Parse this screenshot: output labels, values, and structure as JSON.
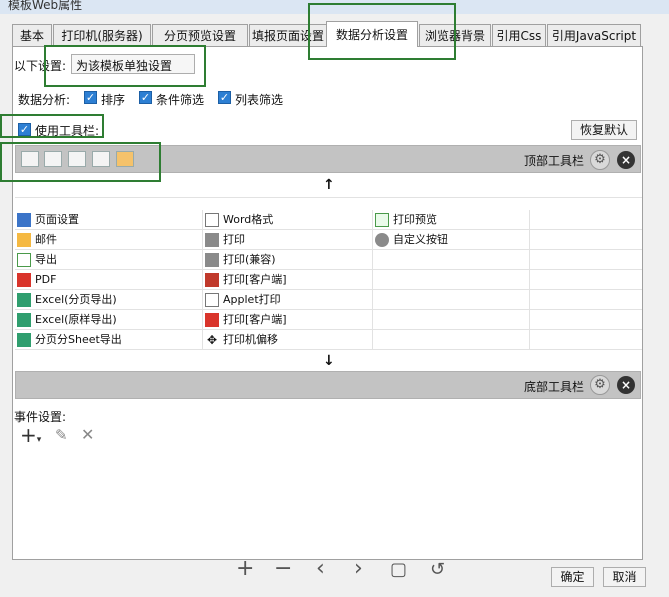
{
  "window": {
    "title": "模板Web属性"
  },
  "tabs": [
    "基本",
    "打印机(服务器)",
    "分页预览设置",
    "填报页面设置",
    "数据分析设置",
    "浏览器背景",
    "引用Css",
    "引用JavaScript"
  ],
  "settings": {
    "label": "以下设置:",
    "value": "为该模板单独设置"
  },
  "analysis": {
    "label": "数据分析:",
    "options": [
      "排序",
      "条件筛选",
      "列表筛选"
    ]
  },
  "use_toolbar": "使用工具栏:",
  "restore_button": "恢复默认",
  "top_toolbar": "顶部工具栏",
  "bottom_toolbar": "底部工具栏",
  "items": [
    [
      "页面设置",
      "Word格式",
      "打印预览"
    ],
    [
      "邮件",
      "打印",
      "自定义按钮"
    ],
    [
      "导出",
      "打印(兼容)",
      ""
    ],
    [
      "PDF",
      "打印[客户端]",
      ""
    ],
    [
      "Excel(分页导出)",
      "Applet打印",
      ""
    ],
    [
      "Excel(原样导出)",
      "打印[客户端]",
      ""
    ],
    [
      "分页分Sheet导出",
      "打印机偏移",
      ""
    ]
  ],
  "events": {
    "label": "事件设置:"
  },
  "footer": {
    "ok": "确定",
    "cancel": "取消"
  },
  "colors": {
    "accent": "#2d7fd3",
    "highlight_box": "#2e7d32",
    "toolbar_bg": "#c3c3c3"
  }
}
